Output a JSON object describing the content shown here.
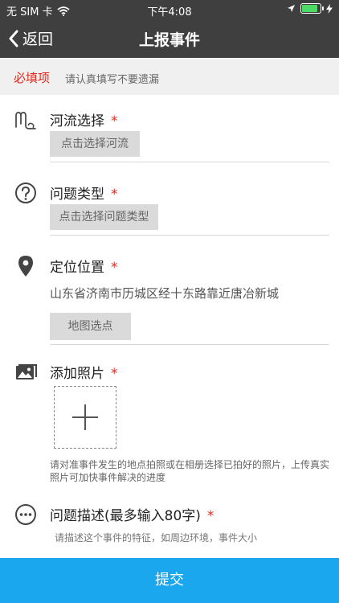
{
  "status": {
    "carrier": "无 SIM 卡",
    "time": "下午4:08"
  },
  "nav": {
    "back_label": "返回",
    "title": "上报事件"
  },
  "notice": {
    "required": "必填项",
    "hint": "请认真填写不要遗漏"
  },
  "fields": {
    "river": {
      "label": "河流选择",
      "star": "*",
      "button": "点击选择河流",
      "icon": "river-icon"
    },
    "problem_type": {
      "label": "问题类型",
      "star": "*",
      "button": "点击选择问题类型",
      "icon": "question-icon"
    },
    "location": {
      "label": "定位位置",
      "star": "*",
      "address": "山东省济南市历城区经十东路靠近唐冶新城",
      "button": "地图选点",
      "icon": "location-pin-icon"
    },
    "photos": {
      "label": "添加照片",
      "star": "*",
      "hint": "请对准事件发生的地点拍照或在相册选择已拍好的照片，上传真实照片可加快事件解决的进度",
      "icon": "photos-icon"
    },
    "description": {
      "label": "问题描述(最多输入80字)",
      "star": "*",
      "placeholder": "请描述这个事件的特征，如周边环境，事件大小",
      "icon": "more-icon"
    }
  },
  "submit_label": "提交",
  "colors": {
    "nav_bg": "#3f3f3f",
    "accent": "#1aa7ee",
    "required_red": "#e02b20"
  }
}
